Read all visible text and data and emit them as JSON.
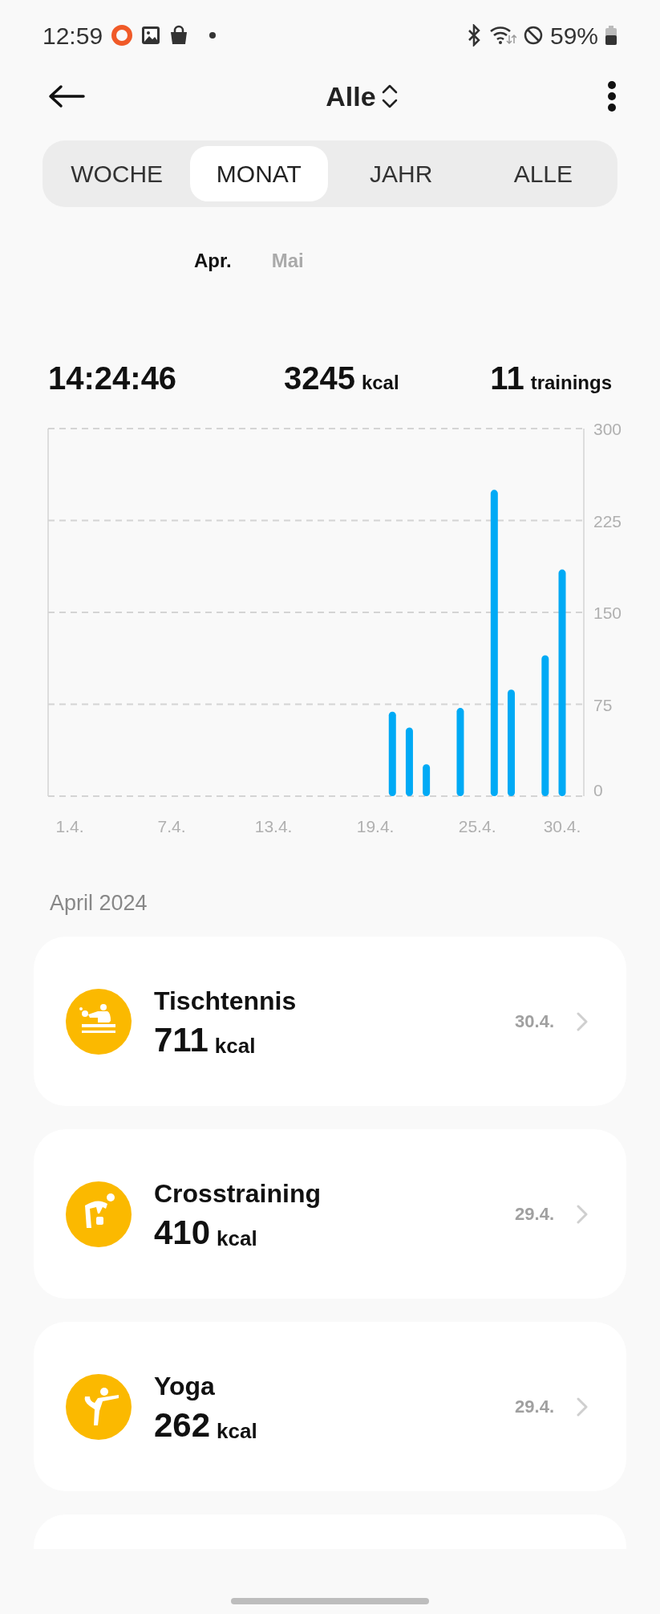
{
  "status_bar": {
    "time": "12:59",
    "battery": "59%"
  },
  "header": {
    "title": "Alle"
  },
  "tabs": [
    {
      "label": "WOCHE",
      "selected": false
    },
    {
      "label": "MONAT",
      "selected": true
    },
    {
      "label": "JAHR",
      "selected": false
    },
    {
      "label": "ALLE",
      "selected": false
    }
  ],
  "months": [
    {
      "label": "Apr.",
      "selected": true
    },
    {
      "label": "Mai",
      "selected": false
    }
  ],
  "summary": {
    "duration": "14:24:46",
    "calories": "3245",
    "calories_unit": "kcal",
    "trainings": "11",
    "trainings_unit": "trainings"
  },
  "chart_data": {
    "type": "bar",
    "categories": [
      "1.4.",
      null,
      null,
      null,
      null,
      null,
      "7.4.",
      null,
      null,
      null,
      null,
      null,
      "13.4.",
      null,
      null,
      null,
      null,
      null,
      "19.4.",
      null,
      null,
      null,
      null,
      null,
      "25.4.",
      null,
      null,
      null,
      null,
      "30.4."
    ],
    "grid": true,
    "series": [
      {
        "color": "#00aaf5",
        "values": [
          null,
          null,
          null,
          null,
          null,
          null,
          null,
          null,
          null,
          null,
          null,
          null,
          null,
          null,
          null,
          null,
          null,
          null,
          null,
          69,
          56,
          26,
          null,
          72,
          null,
          250,
          87,
          null,
          115,
          185
        ]
      }
    ],
    "ylim": [
      0,
      300
    ],
    "yticks": [
      0,
      75,
      150,
      225,
      300
    ]
  },
  "section_title": "April 2024",
  "workouts": [
    {
      "kind": "table-tennis",
      "name": "Tischtennis",
      "calories": "711",
      "unit": "kcal",
      "date": "30.4."
    },
    {
      "kind": "cross-training",
      "name": "Crosstraining",
      "calories": "410",
      "unit": "kcal",
      "date": "29.4."
    },
    {
      "kind": "yoga",
      "name": "Yoga",
      "calories": "262",
      "unit": "kcal",
      "date": "29.4."
    }
  ]
}
